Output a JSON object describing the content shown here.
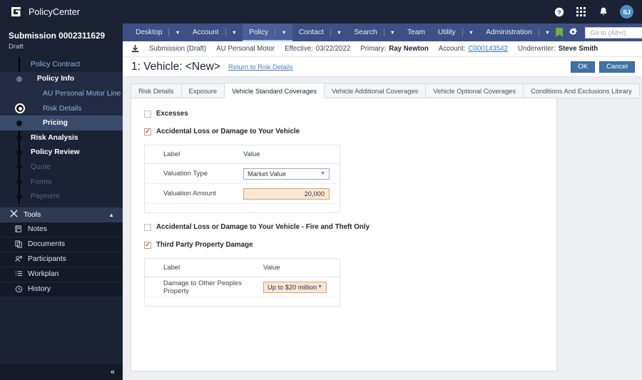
{
  "brand": {
    "name": "PolicyCenter",
    "logo_icon": "policycenter-logo-icon"
  },
  "submission": {
    "title": "Submission 0002311629",
    "status": "Draft"
  },
  "sidebar": {
    "nav": [
      {
        "label": "Policy Contract",
        "level": 0,
        "style": "link",
        "marker": "none"
      },
      {
        "label": "Policy Info",
        "level": 1,
        "style": "white",
        "marker": "grey",
        "highlight": "hl"
      },
      {
        "label": "AU Personal Motor Line",
        "level": 2,
        "style": "link",
        "marker": "none",
        "highlight": "hl"
      },
      {
        "label": "Risk Details",
        "level": 2,
        "style": "link",
        "marker": "ring",
        "highlight": "hl"
      },
      {
        "label": "Pricing",
        "level": 2,
        "style": "sel",
        "marker": "filled",
        "highlight": "sel"
      },
      {
        "label": "Risk Analysis",
        "level": 0,
        "style": "white",
        "marker": "filled"
      },
      {
        "label": "Policy Review",
        "level": 0,
        "style": "white",
        "marker": "filled"
      },
      {
        "label": "Quote",
        "level": 0,
        "style": "dim",
        "marker": "filled"
      },
      {
        "label": "Forms",
        "level": 0,
        "style": "dim",
        "marker": "filled"
      },
      {
        "label": "Payment",
        "level": 0,
        "style": "dim",
        "marker": "filled"
      }
    ],
    "tools": {
      "label": "Tools",
      "icon": "tools-icon",
      "chevron": "▲",
      "items": [
        {
          "label": "Notes",
          "icon": "notes-icon"
        },
        {
          "label": "Documents",
          "icon": "documents-icon"
        },
        {
          "label": "Participants",
          "icon": "participants-icon"
        },
        {
          "label": "Workplan",
          "icon": "workplan-icon"
        },
        {
          "label": "History",
          "icon": "history-icon"
        }
      ]
    },
    "collapse_glyph": "«"
  },
  "topbar": {
    "icons": [
      {
        "name": "help-icon"
      },
      {
        "name": "apps-grid-icon"
      },
      {
        "name": "notifications-bell-icon"
      }
    ],
    "avatar_initials": "SJ"
  },
  "menubar": {
    "items": [
      {
        "label": "Desktop",
        "accel": "k",
        "caret": true,
        "active": false
      },
      {
        "label": "Account",
        "accel": "c",
        "caret": true,
        "active": false
      },
      {
        "label": "Policy",
        "accel": "P",
        "caret": true,
        "active": true
      },
      {
        "label": "Contact",
        "accel": "C",
        "caret": true,
        "active": false
      },
      {
        "label": "Search",
        "accel": "h",
        "caret": true,
        "active": false
      },
      {
        "label": "Team",
        "accel": "T",
        "caret": false,
        "active": false
      },
      {
        "label": "Utility",
        "accel": "U",
        "caret": true,
        "active": false
      },
      {
        "label": "Administration",
        "accel": "A",
        "caret": true,
        "active": false
      }
    ],
    "bookmark_icon": "bookmark-icon",
    "gear_icon": "gear-icon",
    "search_placeholder": "Go to (Alt+/)"
  },
  "infobar": {
    "download_icon": "download-icon",
    "type": "Submission (Draft)",
    "product": "AU Personal Motor",
    "effective_label": "Effective:",
    "effective_value": "03/22/2022",
    "primary_label": "Primary:",
    "primary_value": "Ray Newton",
    "account_label": "Account:",
    "account_value": "C000143542",
    "underwriter_label": "Underwriter:",
    "underwriter_value": "Steve Smith"
  },
  "page": {
    "title": "1: Vehicle: <New>",
    "return_link": "Return to Risk Details",
    "ok_label": "OK",
    "cancel_label": "Cancel"
  },
  "tabs": [
    {
      "label": "Risk Details",
      "selected": false
    },
    {
      "label": "Exposure",
      "selected": false
    },
    {
      "label": "Vehicle Standard Coverages",
      "selected": true
    },
    {
      "label": "Vehicle Additional Coverages",
      "selected": false
    },
    {
      "label": "Vehicle Optional Coverages",
      "selected": false
    },
    {
      "label": "Conditions And Exclusions Library",
      "selected": false
    }
  ],
  "coverages": [
    {
      "label": "Excesses",
      "checked": false,
      "table": null
    },
    {
      "label": "Accidental Loss or Damage to Your Vehicle",
      "checked": true,
      "table": {
        "headers": [
          "Label",
          "Value"
        ],
        "rows": [
          {
            "label": "Valuation Type",
            "control": "select",
            "value": "Market Value",
            "required": false
          },
          {
            "label": "Valuation Amount",
            "control": "text",
            "value": "20,000",
            "required": true
          }
        ]
      }
    },
    {
      "label": "Accidental Loss or Damage to Your Vehicle - Fire and Theft Only",
      "checked": false,
      "table": null
    },
    {
      "label": "Third Party Property Damage",
      "checked": true,
      "table": {
        "headers": [
          "Label",
          "Value"
        ],
        "rows": [
          {
            "label": "Damage to Other Peoples Property",
            "control": "select",
            "value": "Up to $20 million",
            "required": true
          }
        ]
      }
    }
  ],
  "colors": {
    "sidebar_bg": "#1b2234",
    "menubar_bg": "#3d5085",
    "accent_button": "#3f72a6",
    "required_field": "#fae7d2",
    "link": "#3a7bbf",
    "bookmark_green": "#6cb33f"
  }
}
